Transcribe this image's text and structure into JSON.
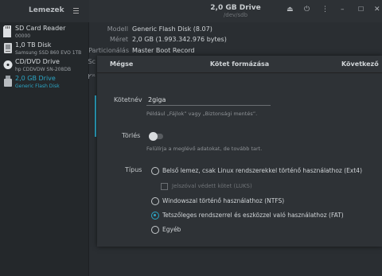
{
  "sidebar": {
    "title": "Lemezek",
    "drives": [
      {
        "name": "SD Card Reader",
        "sub": "00000",
        "icon": "sd-card-icon"
      },
      {
        "name": "1,0 TB Disk",
        "sub": "Samsung SSD 860 EVO 1TB",
        "icon": "hard-disk-icon"
      },
      {
        "name": "CD/DVD Drive",
        "sub": "hp         CDDVDW SN-208DB",
        "icon": "optical-disc-icon"
      },
      {
        "name": "2,0 GB Drive",
        "sub": "Generic Flash Disk",
        "icon": "usb-drive-icon"
      }
    ]
  },
  "header": {
    "title": "2,0 GB Drive",
    "subtitle": "/dev/sdb"
  },
  "info": [
    {
      "label": "Modell",
      "value": "Generic Flash Disk (8.07)"
    },
    {
      "label": "Méret",
      "value": "2,0 GB (1.993.342.976 bytes)"
    },
    {
      "label": "Particionálás",
      "value": "Master Boot Record"
    },
    {
      "label": "Sc",
      "value": ""
    },
    {
      "label": "Kö",
      "value": ""
    }
  ],
  "dialog": {
    "cancel": "Mégse",
    "title": "Kötet formázása",
    "next": "Következő",
    "name_label": "Kötetnév",
    "name_value": "2giga",
    "name_hint": "Például „Fájlok” vagy „Biztonsági mentés”.",
    "erase_label": "Törlés",
    "erase_hint": "Felülírja a meglévő adatokat, de tovább tart.",
    "type_label": "Típus",
    "options": [
      "Belső lemez, csak Linux rendszerekkel történő használathoz (Ext4)",
      "Jelszóval védett kötet (LUKS)",
      "Windowszal történő használathoz (NTFS)",
      "Tetszőleges rendszerrel és eszközzel való használathoz (FAT)",
      "Egyéb"
    ],
    "selected_option": 3
  },
  "colors": {
    "accent": "#2ca6c5"
  }
}
